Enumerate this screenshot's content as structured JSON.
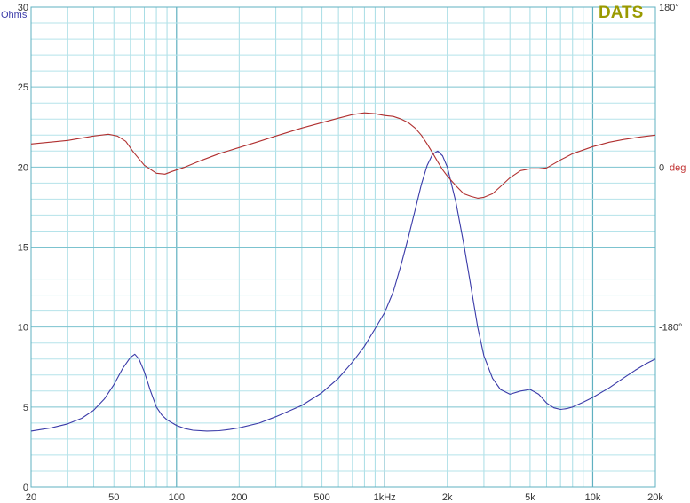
{
  "chart_data": {
    "type": "line",
    "title": "",
    "xscale": "log",
    "xlim": [
      20,
      20000
    ],
    "ylim": [
      0,
      30
    ],
    "y2lim": [
      -360,
      180
    ],
    "grid": true,
    "x_ticks": [
      {
        "value": 20,
        "label": "20"
      },
      {
        "value": 50,
        "label": "50"
      },
      {
        "value": 100,
        "label": "100"
      },
      {
        "value": 200,
        "label": "200"
      },
      {
        "value": 500,
        "label": "500"
      },
      {
        "value": 1000,
        "label": "1kHz"
      },
      {
        "value": 2000,
        "label": "2k"
      },
      {
        "value": 5000,
        "label": "5k"
      },
      {
        "value": 10000,
        "label": "10k"
      },
      {
        "value": 20000,
        "label": "20k"
      }
    ],
    "y_ticks": [
      {
        "value": 0,
        "label": "0"
      },
      {
        "value": 5,
        "label": "5"
      },
      {
        "value": 10,
        "label": "10"
      },
      {
        "value": 15,
        "label": "15"
      },
      {
        "value": 20,
        "label": "20"
      },
      {
        "value": 25,
        "label": "25"
      },
      {
        "value": 30,
        "label": "30"
      }
    ],
    "y2_ticks": [
      {
        "value": 180,
        "label": "180°"
      },
      {
        "value": 0,
        "label": "0"
      },
      {
        "value": -180,
        "label": "-180°"
      }
    ],
    "y_unit_label": "Ohms",
    "y2_unit_label": "deg",
    "watermark": "DATS",
    "series": [
      {
        "axis": "left",
        "color": "#3a3aa8",
        "x": [
          20,
          25,
          30,
          35,
          40,
          45,
          50,
          55,
          60,
          63,
          66,
          70,
          75,
          80,
          85,
          90,
          100,
          110,
          120,
          140,
          160,
          180,
          200,
          250,
          300,
          400,
          500,
          600,
          700,
          800,
          900,
          1000,
          1100,
          1200,
          1300,
          1400,
          1500,
          1600,
          1700,
          1800,
          1900,
          2000,
          2200,
          2400,
          2600,
          2800,
          3000,
          3300,
          3600,
          4000,
          4500,
          5000,
          5500,
          6000,
          6500,
          7000,
          7500,
          8000,
          9000,
          10000,
          12000,
          14000,
          16000,
          18000,
          20000
        ],
        "values": [
          3.5,
          3.7,
          3.95,
          4.3,
          4.8,
          5.5,
          6.4,
          7.4,
          8.1,
          8.3,
          8.0,
          7.2,
          6.0,
          5.0,
          4.5,
          4.2,
          3.85,
          3.65,
          3.55,
          3.5,
          3.52,
          3.6,
          3.7,
          4.0,
          4.4,
          5.1,
          5.9,
          6.8,
          7.8,
          8.8,
          9.9,
          10.9,
          12.2,
          13.9,
          15.6,
          17.3,
          18.9,
          20.1,
          20.8,
          21.0,
          20.7,
          20.0,
          17.8,
          15.2,
          12.5,
          10.0,
          8.2,
          6.8,
          6.1,
          5.8,
          6.0,
          6.1,
          5.8,
          5.25,
          4.95,
          4.85,
          4.9,
          5.0,
          5.3,
          5.6,
          6.2,
          6.8,
          7.3,
          7.7,
          8.0
        ]
      },
      {
        "axis": "right",
        "color": "#b03030",
        "x": [
          20,
          30,
          40,
          47,
          52,
          57,
          62,
          70,
          80,
          88,
          95,
          110,
          130,
          160,
          200,
          250,
          300,
          400,
          500,
          600,
          700,
          800,
          900,
          1000,
          1100,
          1200,
          1300,
          1400,
          1500,
          1600,
          1700,
          1800,
          1900,
          2000,
          2200,
          2400,
          2600,
          2800,
          3000,
          3300,
          3600,
          4000,
          4500,
          5000,
          5500,
          6000,
          7000,
          8000,
          10000,
          12000,
          14000,
          17000,
          20000
        ],
        "values": [
          26,
          30,
          35,
          37,
          35,
          29,
          17,
          2,
          -7,
          -8,
          -5,
          0,
          7,
          15,
          22,
          29,
          35,
          44,
          50,
          55,
          59,
          61,
          60,
          58,
          57,
          54,
          50,
          44,
          36,
          26,
          16,
          6,
          -3,
          -10,
          -21,
          -30,
          -33,
          -35,
          -34,
          -30,
          -22,
          -12,
          -4,
          -2,
          -2,
          -1,
          8,
          15,
          23,
          28,
          31,
          34,
          36
        ]
      }
    ]
  }
}
